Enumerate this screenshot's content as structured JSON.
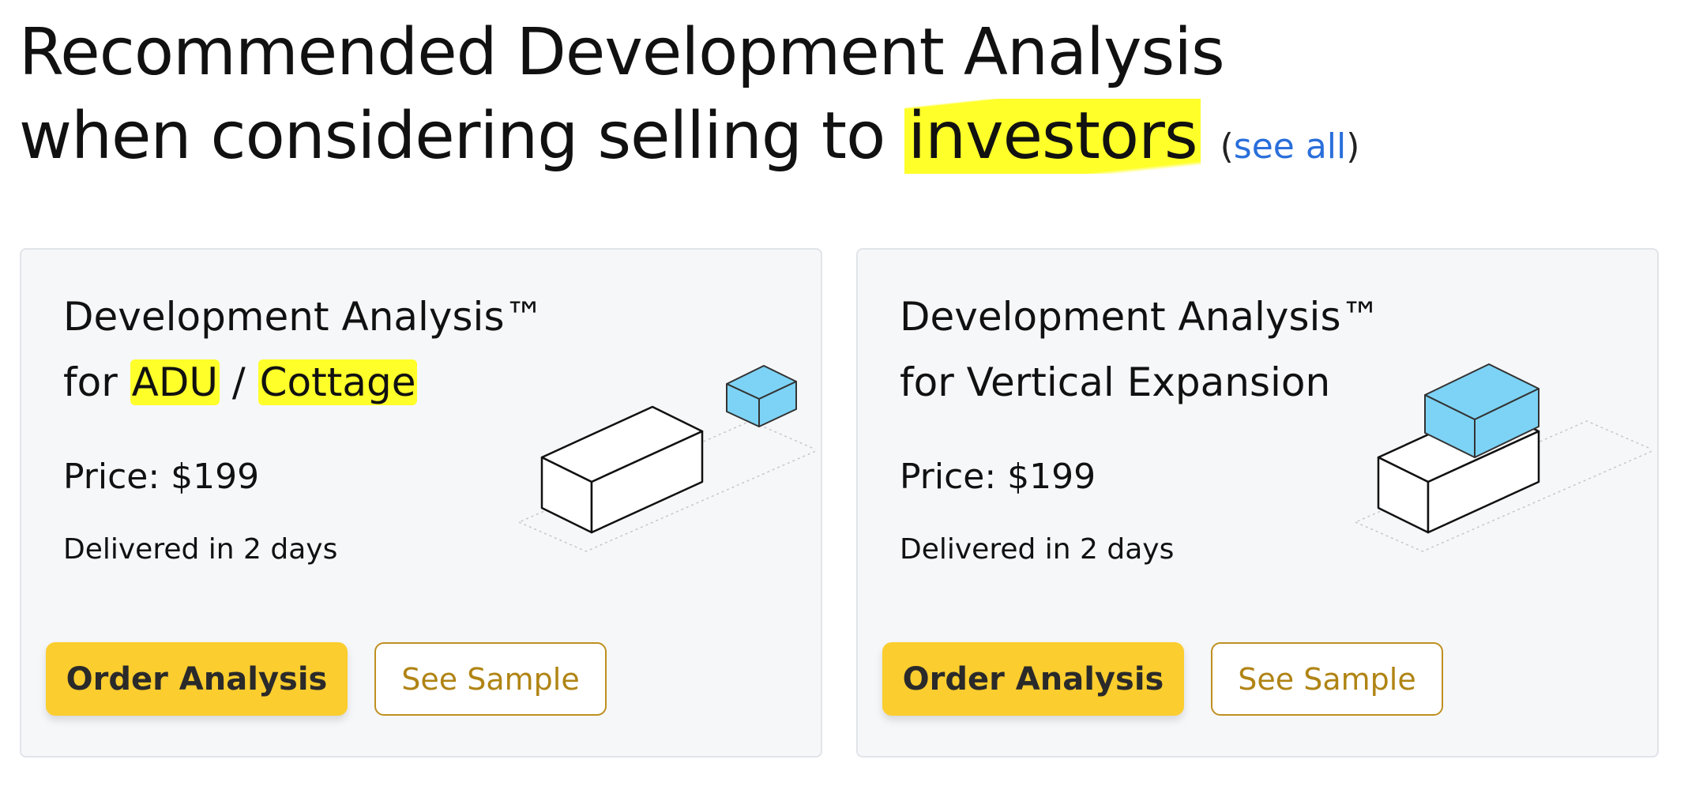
{
  "heading": {
    "line1": "Recommended Development Analysis",
    "line2_prefix": "when considering selling to ",
    "line2_highlight": "investors",
    "see_all_open": "(",
    "see_all_link": "see all",
    "see_all_close": ")"
  },
  "cards": [
    {
      "title_line1": "Development Analysis™",
      "title_for": "for ",
      "title_hl1": "ADU",
      "title_sep": " / ",
      "title_hl2": "Cottage",
      "price": "Price: $199",
      "delivery": "Delivered in 2 days",
      "order_label": "Order Analysis",
      "sample_label": "See Sample",
      "illustration": "adu-cottage-isometric-icon"
    },
    {
      "title_line1": "Development Analysis™",
      "title_line2": "for Vertical Expansion",
      "price": "Price: $199",
      "delivery": "Delivered in 2 days",
      "order_label": "Order Analysis",
      "sample_label": "See Sample",
      "illustration": "vertical-expansion-isometric-icon"
    }
  ],
  "colors": {
    "highlight": "#ffff2a",
    "link": "#2a6fdb",
    "order_button": "#fbcd2e",
    "sample_border": "#bf9020",
    "sample_text": "#b08414",
    "card_background": "#f6f7f9",
    "box_blue": "#7dd3f5"
  }
}
